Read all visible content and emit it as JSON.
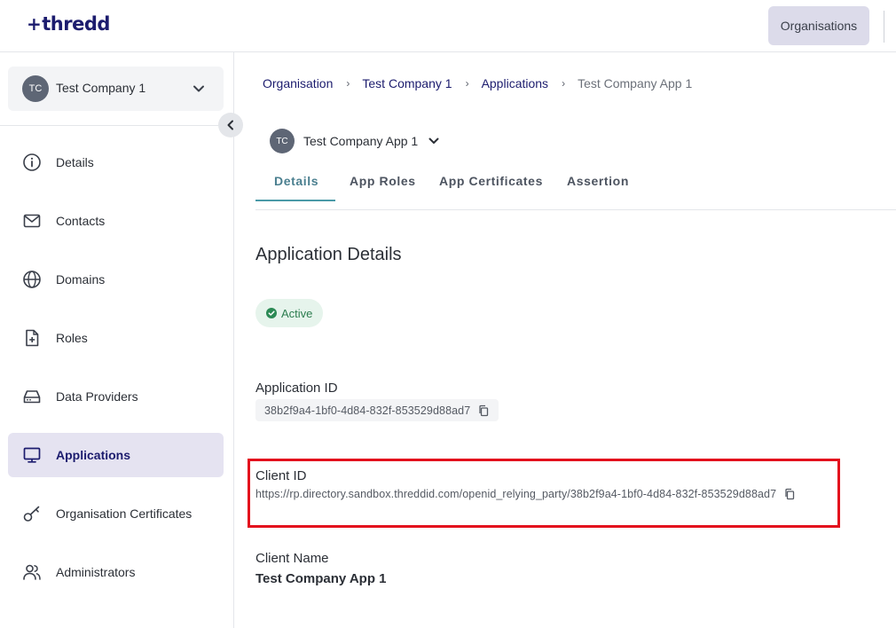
{
  "header": {
    "logo_text": "thredd",
    "organisations_button": "Organisations"
  },
  "sidebar": {
    "company": {
      "initials": "TC",
      "name": "Test Company 1"
    },
    "items": [
      {
        "label": "Details",
        "icon": "info-icon"
      },
      {
        "label": "Contacts",
        "icon": "mail-icon"
      },
      {
        "label": "Domains",
        "icon": "globe-icon"
      },
      {
        "label": "Roles",
        "icon": "file-plus-icon"
      },
      {
        "label": "Data Providers",
        "icon": "drive-icon"
      },
      {
        "label": "Applications",
        "icon": "monitor-icon",
        "active": true
      },
      {
        "label": "Organisation Certificates",
        "icon": "key-icon"
      },
      {
        "label": "Administrators",
        "icon": "users-icon"
      }
    ]
  },
  "breadcrumb": {
    "items": [
      "Organisation",
      "Test Company 1",
      "Applications"
    ],
    "current": "Test Company App 1"
  },
  "app_selector": {
    "initials": "TC",
    "name": "Test Company App 1"
  },
  "tabs": [
    "Details",
    "App Roles",
    "App Certificates",
    "Assertion"
  ],
  "active_tab": "Details",
  "details": {
    "title": "Application Details",
    "status": "Active",
    "application_id_label": "Application ID",
    "application_id": "38b2f9a4-1bf0-4d84-832f-853529d88ad7",
    "client_id_label": "Client ID",
    "client_id": "https://rp.directory.sandbox.threddid.com/openid_relying_party/38b2f9a4-1bf0-4d84-832f-853529d88ad7",
    "client_name_label": "Client Name",
    "client_name": "Test Company App 1"
  },
  "colors": {
    "brand": "#1c1c6e",
    "active_nav_bg": "#e5e3f1",
    "tab_active": "#4a7f8f",
    "status_green": "#2c7d4f",
    "highlight_red": "#e3101d"
  }
}
